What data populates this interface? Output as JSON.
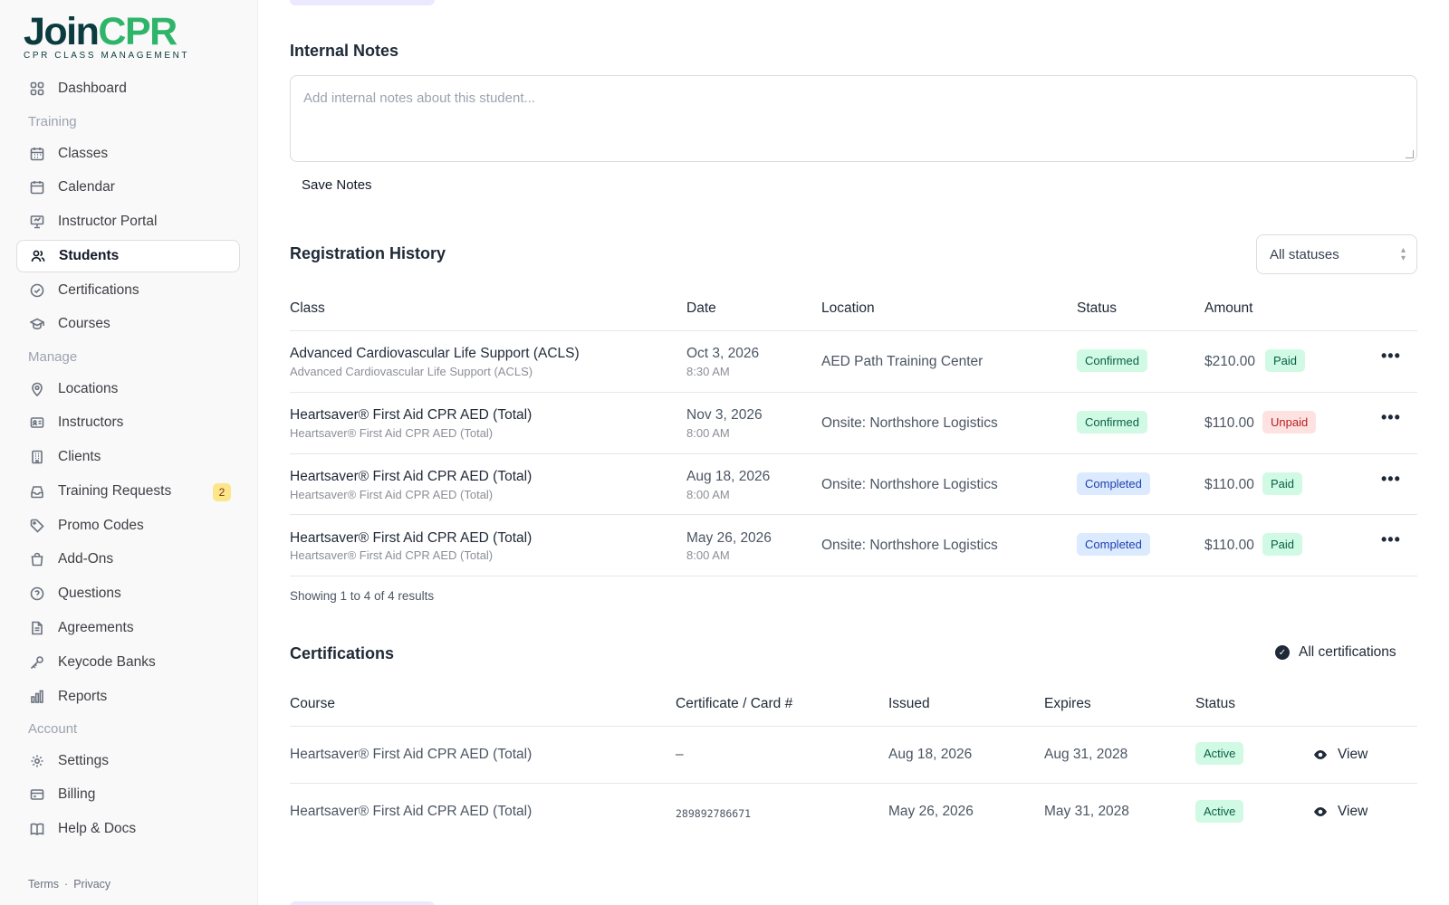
{
  "brand": {
    "part1": "Join",
    "part2": "CPR",
    "subtitle": "CPR CLASS MANAGEMENT"
  },
  "sidebar": {
    "items": [
      {
        "label": "Dashboard",
        "icon": "dashboard-icon"
      },
      {
        "label": "Classes",
        "icon": "calendar-grid-icon"
      },
      {
        "label": "Calendar",
        "icon": "calendar-icon"
      },
      {
        "label": "Instructor Portal",
        "icon": "presentation-icon"
      },
      {
        "label": "Students",
        "icon": "users-icon"
      },
      {
        "label": "Certifications",
        "icon": "check-circle-icon"
      },
      {
        "label": "Courses",
        "icon": "graduation-cap-icon"
      },
      {
        "label": "Locations",
        "icon": "map-pin-icon"
      },
      {
        "label": "Instructors",
        "icon": "id-card-icon"
      },
      {
        "label": "Clients",
        "icon": "building-icon"
      },
      {
        "label": "Training Requests",
        "icon": "inbox-icon",
        "badge": "2"
      },
      {
        "label": "Promo Codes",
        "icon": "tag-icon"
      },
      {
        "label": "Add-Ons",
        "icon": "shopping-bag-icon"
      },
      {
        "label": "Questions",
        "icon": "help-circle-icon"
      },
      {
        "label": "Agreements",
        "icon": "file-text-icon"
      },
      {
        "label": "Keycode Banks",
        "icon": "key-icon"
      },
      {
        "label": "Reports",
        "icon": "bar-chart-icon"
      },
      {
        "label": "Settings",
        "icon": "gear-icon"
      },
      {
        "label": "Billing",
        "icon": "credit-card-icon"
      },
      {
        "label": "Help & Docs",
        "icon": "book-icon"
      }
    ],
    "sections": {
      "training": "Training",
      "manage": "Manage",
      "account": "Account"
    },
    "footer": {
      "terms": "Terms",
      "sep": "·",
      "privacy": "Privacy"
    }
  },
  "notes": {
    "title": "Internal Notes",
    "placeholder": "Add internal notes about this student...",
    "save_label": "Save Notes"
  },
  "registrations": {
    "title": "Registration History",
    "filter_value": "All statuses",
    "columns": [
      "Class",
      "Date",
      "Location",
      "Status",
      "Amount"
    ],
    "rows": [
      {
        "class": "Advanced Cardiovascular Life Support (ACLS)",
        "class_sub": "Advanced Cardiovascular Life Support (ACLS)",
        "date": "Oct 3, 2026",
        "time": "8:30 AM",
        "location": "AED Path Training Center",
        "status": "Confirmed",
        "amount": "$210.00",
        "payment": "Paid"
      },
      {
        "class": "Heartsaver® First Aid CPR AED (Total)",
        "class_sub": "Heartsaver® First Aid CPR AED (Total)",
        "date": "Nov 3, 2026",
        "time": "8:00 AM",
        "location": "Onsite: Northshore Logistics",
        "status": "Confirmed",
        "amount": "$110.00",
        "payment": "Unpaid"
      },
      {
        "class": "Heartsaver® First Aid CPR AED (Total)",
        "class_sub": "Heartsaver® First Aid CPR AED (Total)",
        "date": "Aug 18, 2026",
        "time": "8:00 AM",
        "location": "Onsite: Northshore Logistics",
        "status": "Completed",
        "amount": "$110.00",
        "payment": "Paid"
      },
      {
        "class": "Heartsaver® First Aid CPR AED (Total)",
        "class_sub": "Heartsaver® First Aid CPR AED (Total)",
        "date": "May 26, 2026",
        "time": "8:00 AM",
        "location": "Onsite: Northshore Logistics",
        "status": "Completed",
        "amount": "$110.00",
        "payment": "Paid"
      }
    ],
    "more_icon": "more-horizontal-icon",
    "results_text": "Showing 1 to 4 of 4 results"
  },
  "certifications": {
    "title": "Certifications",
    "filter_label": "All certifications",
    "columns": [
      "Course",
      "Certificate / Card #",
      "Issued",
      "Expires",
      "Status"
    ],
    "rows": [
      {
        "course": "Heartsaver® First Aid CPR AED (Total)",
        "card": "–",
        "issued": "Aug 18, 2026",
        "expires": "Aug 31, 2028",
        "status": "Active",
        "action": "View"
      },
      {
        "course": "Heartsaver® First Aid CPR AED (Total)",
        "card": "289892786671",
        "issued": "May 26, 2026",
        "expires": "May 31, 2028",
        "status": "Active",
        "action": "View"
      }
    ]
  },
  "colors": {
    "brand_dark": "#0b3b3e",
    "brand_green": "#2fb56a",
    "badge_confirmed": "#d1fae5",
    "badge_completed": "#dbeafe",
    "badge_unpaid": "#fee2e2"
  }
}
